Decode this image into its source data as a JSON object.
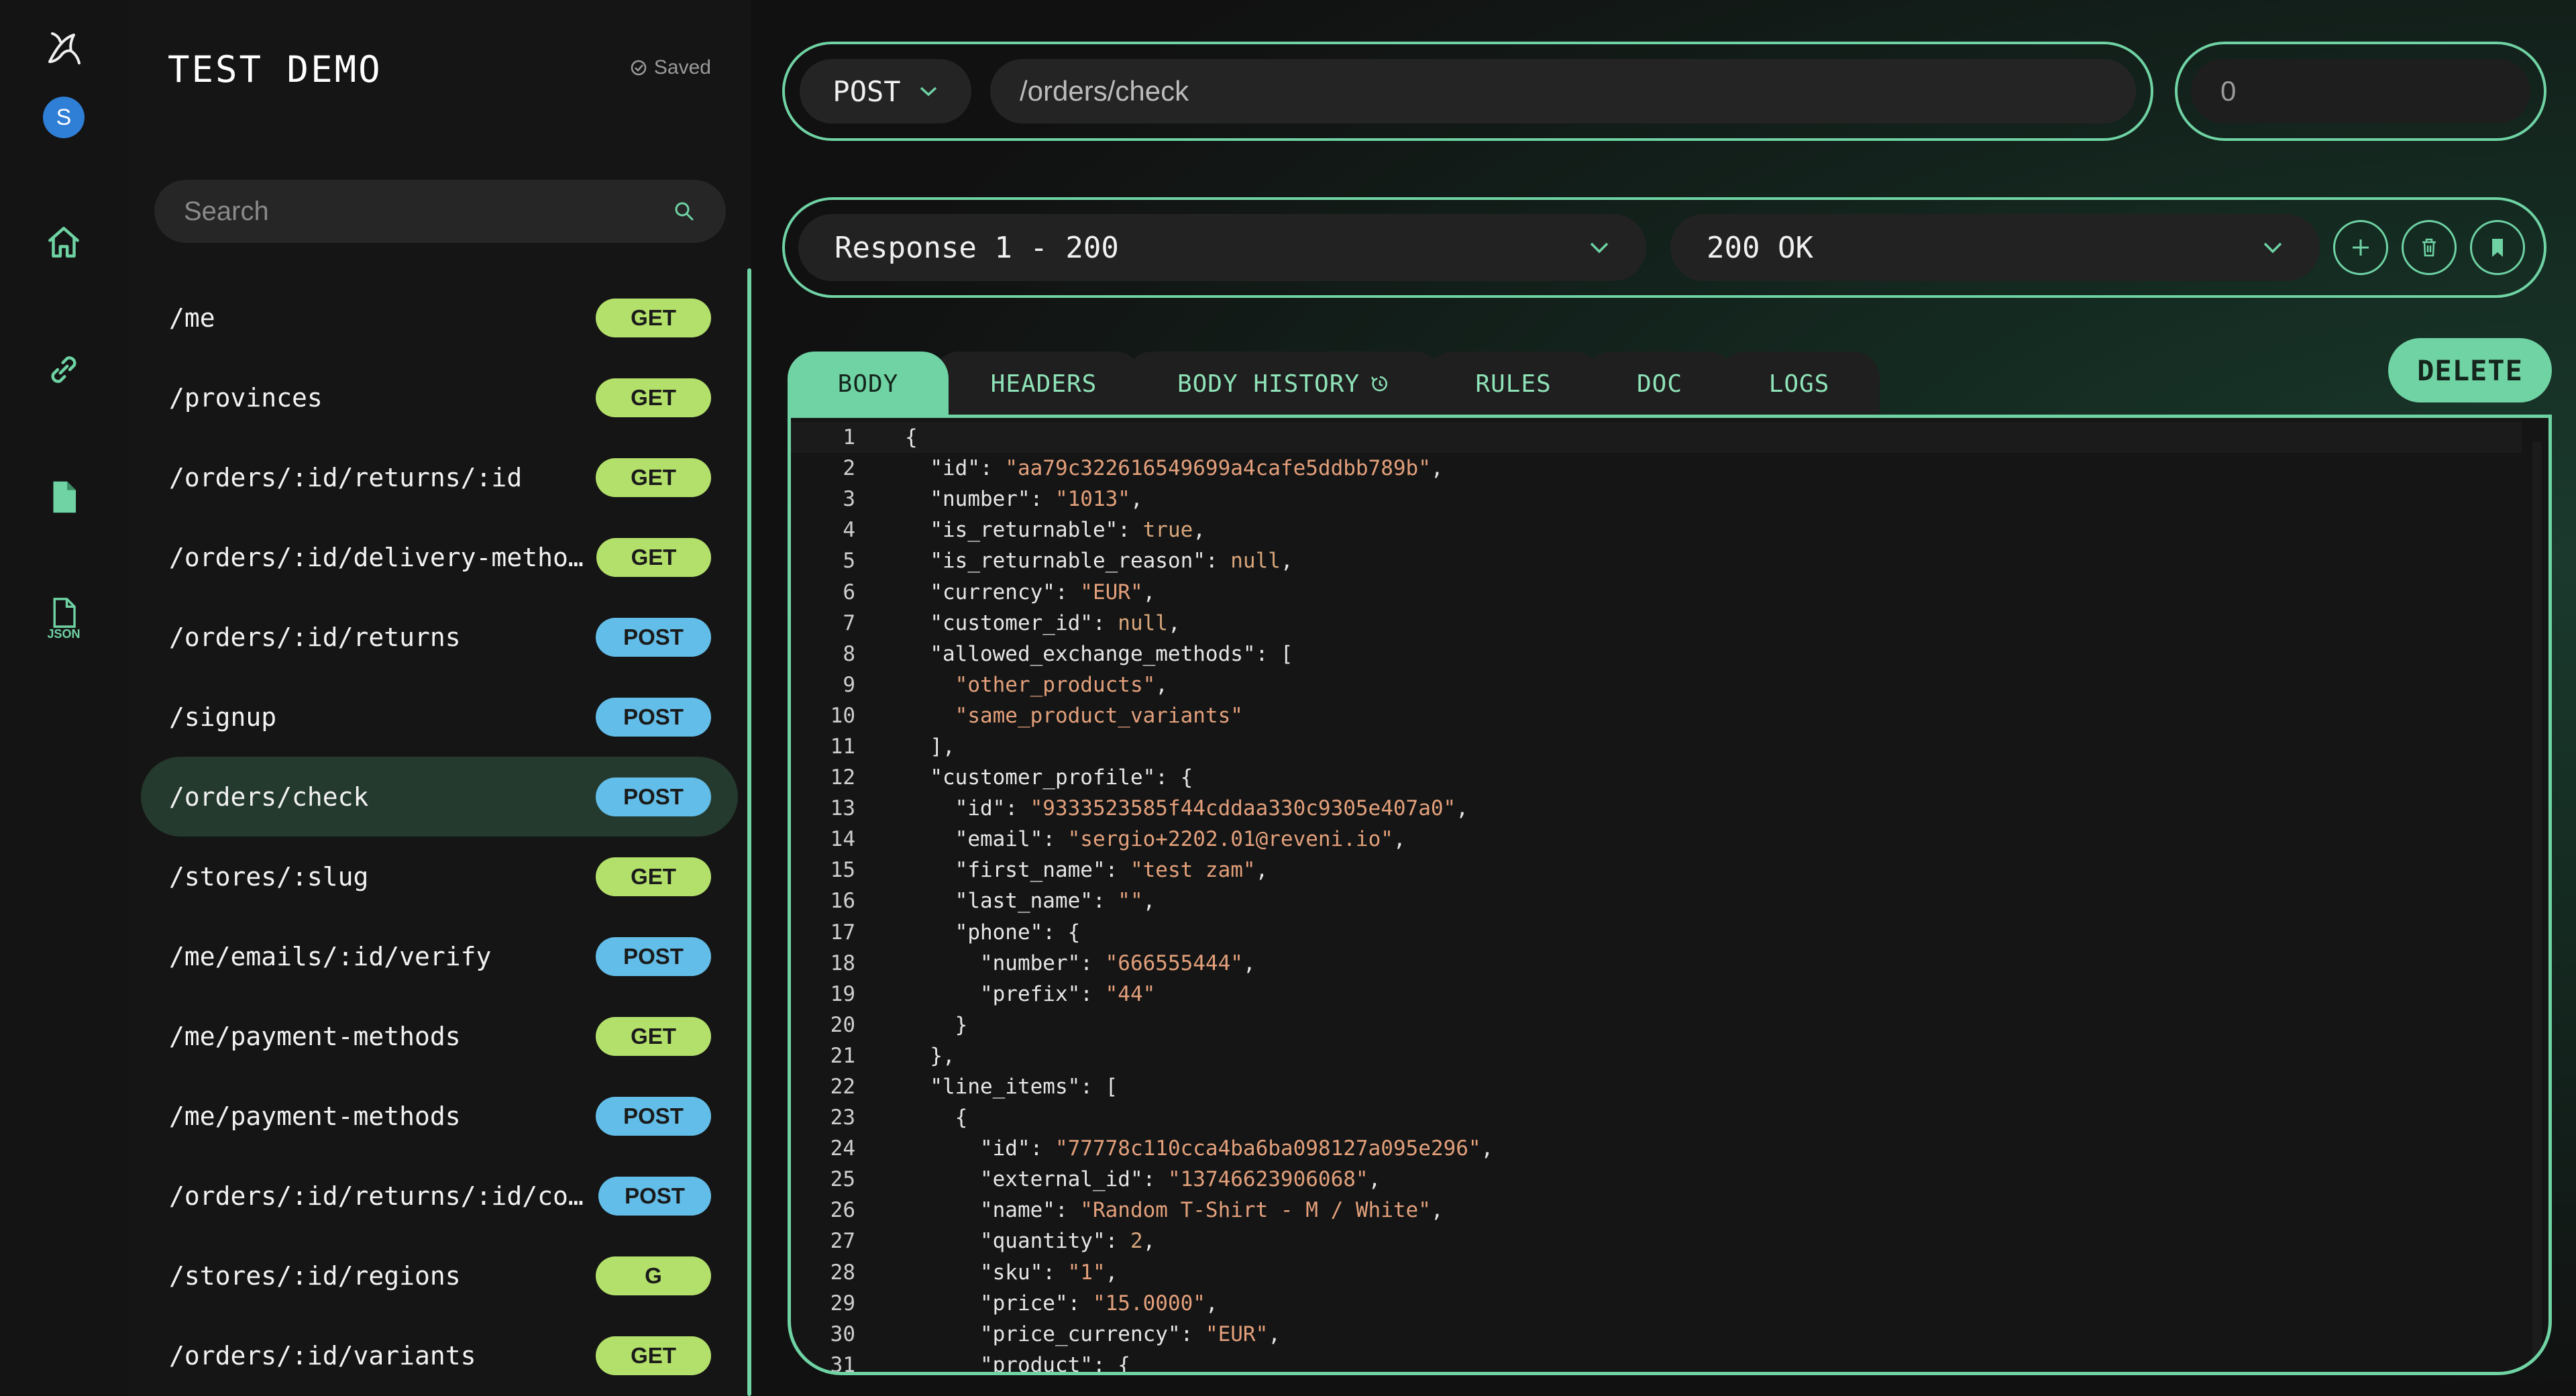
{
  "project": {
    "title": "TEST DEMO",
    "saved_label": "Saved"
  },
  "user": {
    "avatar_initial": "S"
  },
  "search": {
    "placeholder": "Search"
  },
  "endpoints": [
    {
      "path": "/me",
      "method": "GET"
    },
    {
      "path": "/provinces",
      "method": "GET"
    },
    {
      "path": "/orders/:id/returns/:id",
      "method": "GET"
    },
    {
      "path": "/orders/:id/delivery-methods",
      "method": "GET"
    },
    {
      "path": "/orders/:id/returns",
      "method": "POST"
    },
    {
      "path": "/signup",
      "method": "POST"
    },
    {
      "path": "/orders/check",
      "method": "POST",
      "active": true
    },
    {
      "path": "/stores/:slug",
      "method": "GET"
    },
    {
      "path": "/me/emails/:id/verify",
      "method": "POST"
    },
    {
      "path": "/me/payment-methods",
      "method": "GET"
    },
    {
      "path": "/me/payment-methods",
      "method": "POST"
    },
    {
      "path": "/orders/:id/returns/:id/comp…",
      "method": "POST"
    },
    {
      "path": "/stores/:id/regions",
      "method": "G"
    },
    {
      "path": "/orders/:id/variants",
      "method": "GET"
    }
  ],
  "fab_label": "+",
  "request": {
    "method": "POST",
    "url": "/orders/check",
    "delay": "0"
  },
  "response": {
    "selected": "Response 1 - 200",
    "status": "200 OK"
  },
  "tabs": [
    "BODY",
    "HEADERS",
    "BODY HISTORY",
    "RULES",
    "DOC",
    "LOGS"
  ],
  "delete_label": "DELETE",
  "colors": {
    "accent": "#6fd3a4",
    "get": "#b3e06a",
    "post": "#62bde8"
  },
  "code_lines": [
    "{",
    "  \"id\": \"aa79c322616549699a4cafe5ddbb789b\",",
    "  \"number\": \"1013\",",
    "  \"is_returnable\": true,",
    "  \"is_returnable_reason\": null,",
    "  \"currency\": \"EUR\",",
    "  \"customer_id\": null,",
    "  \"allowed_exchange_methods\": [",
    "    \"other_products\",",
    "    \"same_product_variants\"",
    "  ],",
    "  \"customer_profile\": {",
    "    \"id\": \"9333523585f44cddaa330c9305e407a0\",",
    "    \"email\": \"sergio+2202.01@reveni.io\",",
    "    \"first_name\": \"test zam\",",
    "    \"last_name\": \"\",",
    "    \"phone\": {",
    "      \"number\": \"666555444\",",
    "      \"prefix\": \"44\"",
    "    }",
    "  },",
    "  \"line_items\": [",
    "    {",
    "      \"id\": \"77778c110cca4ba6ba098127a095e296\",",
    "      \"external_id\": \"13746623906068\",",
    "      \"name\": \"Random T-Shirt - M / White\",",
    "      \"quantity\": 2,",
    "      \"sku\": \"1\",",
    "      \"price\": \"15.0000\",",
    "      \"price_currency\": \"EUR\",",
    "      \"product\": {"
  ]
}
